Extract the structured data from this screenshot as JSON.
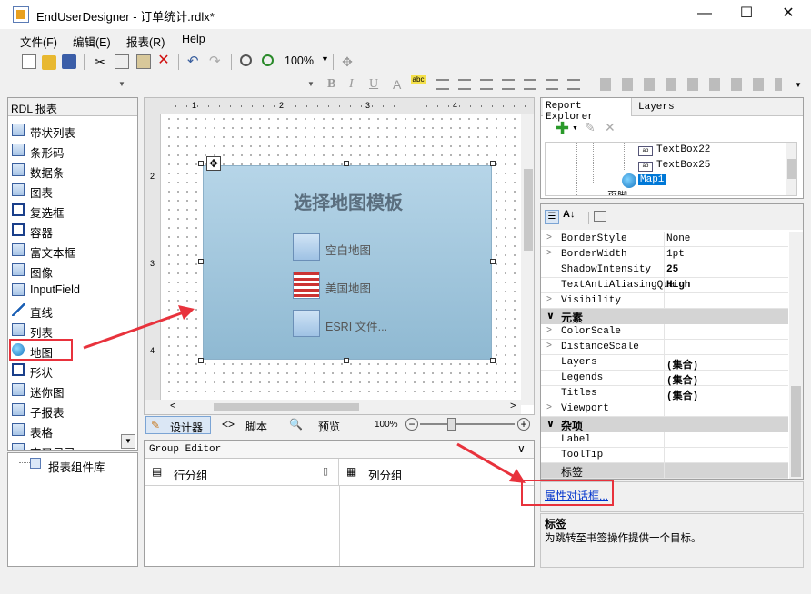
{
  "window": {
    "title": "EndUserDesigner - 订单统计.rdlx*"
  },
  "menu": {
    "file": "文件(F)",
    "edit": "编辑(E)",
    "report": "报表(R)",
    "help": "Help"
  },
  "toolbar": {
    "zoom": "100%"
  },
  "toolbox": {
    "header": "RDL 报表",
    "items": [
      "带状列表",
      "条形码",
      "数据条",
      "图表",
      "复选框",
      "容器",
      "富文本框",
      "图像",
      "InputField",
      "直线",
      "列表",
      "地图",
      "形状",
      "迷你图",
      "子报表",
      "表格",
      "交叉目录"
    ],
    "library": "报表组件库"
  },
  "canvas": {
    "map_title": "选择地图模板",
    "templates": [
      "空白地图",
      "美国地图",
      "ESRI 文件..."
    ],
    "ruler_numbers": [
      "1",
      "2",
      "3",
      "4"
    ],
    "side_numbers": [
      "2",
      "3",
      "4"
    ]
  },
  "bottom_tabs": {
    "designer": "设计器",
    "script": "脚本",
    "preview": "预览",
    "zoom": "100%"
  },
  "group_editor": {
    "title": "Group Editor",
    "row_groups": "行分组",
    "col_groups": "列分组"
  },
  "explorer": {
    "tab_report": "Report Explorer",
    "tab_layers": "Layers",
    "nodes": [
      "TextBox22",
      "TextBox25",
      "Map1",
      "页脚"
    ]
  },
  "properties": {
    "rows": [
      {
        "kind": "prop",
        "name": "BorderStyle",
        "value": "None",
        "expand": true
      },
      {
        "kind": "prop",
        "name": "BorderWidth",
        "value": "1pt",
        "expand": true
      },
      {
        "kind": "prop",
        "name": "ShadowIntensity",
        "value": "25",
        "bold": true
      },
      {
        "kind": "prop",
        "name": "TextAntiAliasingQua",
        "value": "High",
        "bold": true
      },
      {
        "kind": "prop",
        "name": "Visibility",
        "value": "",
        "expand": true
      },
      {
        "kind": "cat",
        "name": "元素"
      },
      {
        "kind": "prop",
        "name": "ColorScale",
        "value": "",
        "expand": true
      },
      {
        "kind": "prop",
        "name": "DistanceScale",
        "value": "",
        "expand": true
      },
      {
        "kind": "prop",
        "name": "Layers",
        "value": "(集合)",
        "bold": true
      },
      {
        "kind": "prop",
        "name": "Legends",
        "value": "(集合)",
        "bold": true
      },
      {
        "kind": "prop",
        "name": "Titles",
        "value": "(集合)",
        "bold": true
      },
      {
        "kind": "prop",
        "name": "Viewport",
        "value": "",
        "expand": true
      },
      {
        "kind": "cat",
        "name": "杂项"
      },
      {
        "kind": "prop",
        "name": "Label",
        "value": ""
      },
      {
        "kind": "prop",
        "name": "ToolTip",
        "value": ""
      },
      {
        "kind": "prop",
        "name": "标签",
        "value": "",
        "selected": true
      }
    ],
    "dialog_link": "属性对话框...",
    "desc_title": "标签",
    "desc_text": "为跳转至书签操作提供一个目标。"
  },
  "colors": {
    "annotation": "#e8323c",
    "accent": "#0078d7"
  }
}
